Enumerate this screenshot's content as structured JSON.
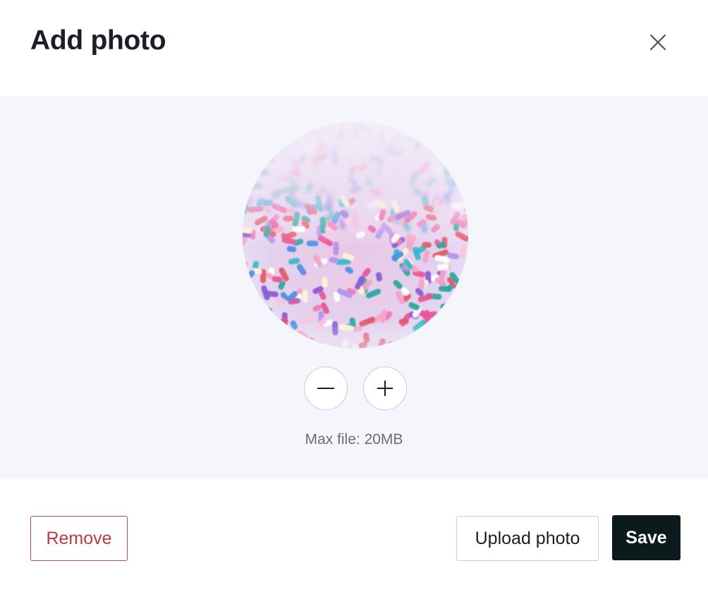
{
  "dialog": {
    "title": "Add photo",
    "close_icon": "close-icon"
  },
  "editor": {
    "image_description": "photo",
    "zoom_out_icon": "minus-icon",
    "zoom_in_icon": "plus-icon",
    "max_file_label": "Max file: 20MB",
    "background_color": "#f5f6fb"
  },
  "footer": {
    "remove_label": "Remove",
    "upload_label": "Upload photo",
    "save_label": "Save"
  },
  "colors": {
    "danger": "#b83c44",
    "primary_button": "#0b1a1d",
    "title_text": "#1d1d26",
    "muted_text": "#6b6d7c",
    "border": "#c9cad3"
  }
}
